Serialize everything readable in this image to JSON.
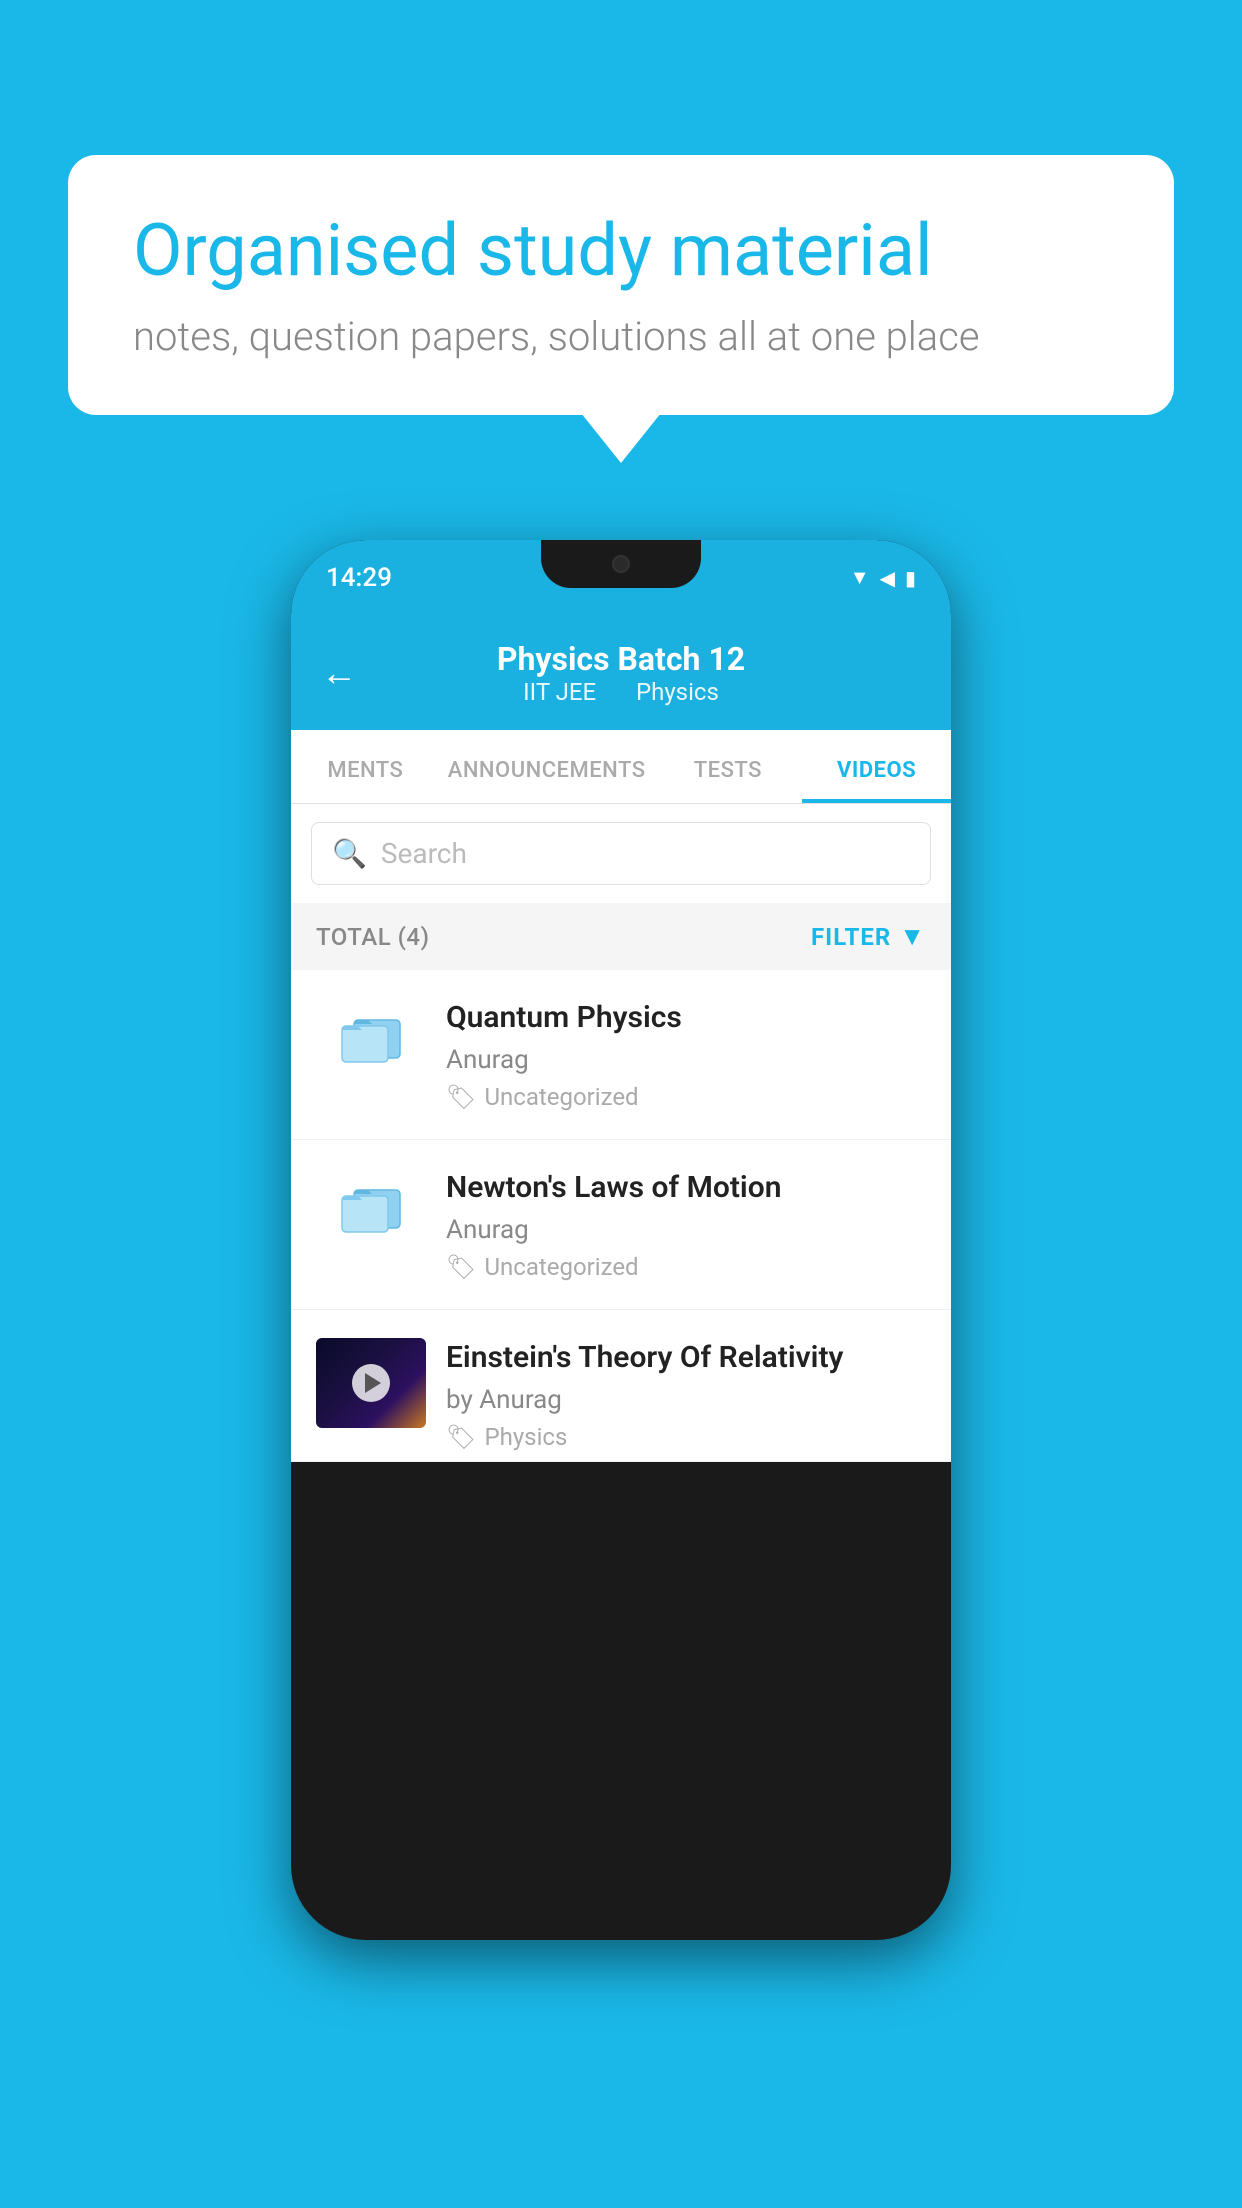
{
  "background_color": "#1ab8e8",
  "speech_bubble": {
    "title": "Organised study material",
    "subtitle": "notes, question papers, solutions all at one place"
  },
  "phone": {
    "status_bar": {
      "time": "14:29",
      "icons": "▼◀▮"
    },
    "header": {
      "title": "Physics Batch 12",
      "subtitle_left": "IIT JEE",
      "subtitle_right": "Physics",
      "back_label": "←"
    },
    "tabs": [
      {
        "label": "MENTS",
        "active": false
      },
      {
        "label": "ANNOUNCEMENTS",
        "active": false
      },
      {
        "label": "TESTS",
        "active": false
      },
      {
        "label": "VIDEOS",
        "active": true
      }
    ],
    "search": {
      "placeholder": "Search"
    },
    "filter_bar": {
      "total_label": "TOTAL (4)",
      "filter_label": "FILTER"
    },
    "videos": [
      {
        "title": "Quantum Physics",
        "author": "Anurag",
        "tag": "Uncategorized",
        "type": "folder"
      },
      {
        "title": "Newton's Laws of Motion",
        "author": "Anurag",
        "tag": "Uncategorized",
        "type": "folder"
      },
      {
        "title": "Einstein's Theory Of Relativity",
        "author": "by Anurag",
        "tag": "Physics",
        "type": "video"
      }
    ]
  }
}
